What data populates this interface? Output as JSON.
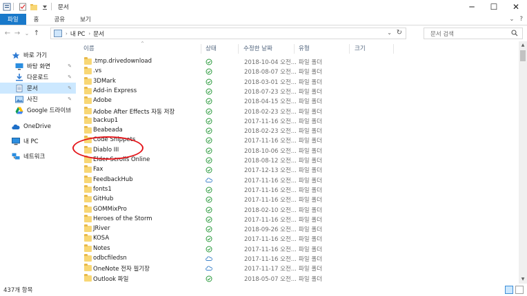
{
  "window": {
    "title": "문서",
    "minimize_glyph": "─",
    "maximize_glyph": "☐",
    "close_glyph": "✕"
  },
  "ribbon": {
    "tabs": [
      "파일",
      "홈",
      "공유",
      "보기"
    ],
    "expand_glyph": "⌄",
    "help_glyph": "?"
  },
  "address": {
    "back_glyph": "←",
    "forward_glyph": "→",
    "recent_glyph": "⌄",
    "up_glyph": "↑",
    "breadcrumb": [
      "내 PC",
      "문서"
    ],
    "separator_glyph": "›",
    "dropdown_glyph": "⌄",
    "refresh_glyph": "↻",
    "search_placeholder": "문서 검색",
    "search_icon": "search-icon"
  },
  "nav": {
    "items": [
      {
        "label": "바로 가기",
        "icon": "star-icon",
        "pinned": false
      },
      {
        "label": "바탕 화면",
        "icon": "desktop-icon",
        "pinned": true
      },
      {
        "label": "다운로드",
        "icon": "download-icon",
        "pinned": true
      },
      {
        "label": "문서",
        "icon": "documents-icon",
        "pinned": true,
        "selected": true
      },
      {
        "label": "사진",
        "icon": "pictures-icon",
        "pinned": true
      },
      {
        "label": "Google 드라이브",
        "icon": "google-drive-icon",
        "pinned": true
      },
      {
        "label": "OneDrive",
        "icon": "onedrive-icon",
        "pinned": false
      },
      {
        "label": "내 PC",
        "icon": "computer-icon",
        "pinned": false
      },
      {
        "label": "네트워크",
        "icon": "network-icon",
        "pinned": false
      }
    ],
    "pin_glyph": "✎"
  },
  "columns": [
    "이름",
    "상태",
    "수정한 날짜",
    "유형",
    "크기"
  ],
  "sort_glyph": "^",
  "files": [
    {
      "name": ".tmp.drivedownload",
      "status": "synced",
      "date": "2018-10-04 오전...",
      "type": "파일 폴더"
    },
    {
      "name": ".vs",
      "status": "synced",
      "date": "2018-08-07 오전...",
      "type": "파일 폴더"
    },
    {
      "name": "3DMark",
      "status": "synced",
      "date": "2018-03-01 오전...",
      "type": "파일 폴더"
    },
    {
      "name": "Add-in Express",
      "status": "synced",
      "date": "2018-07-23 오전...",
      "type": "파일 폴더"
    },
    {
      "name": "Adobe",
      "status": "synced",
      "date": "2018-04-15 오전...",
      "type": "파일 폴더"
    },
    {
      "name": "Adobe After Effects 자동 저장",
      "status": "synced",
      "date": "2018-02-23 오전...",
      "type": "파일 폴더"
    },
    {
      "name": "backup1",
      "status": "synced",
      "date": "2017-11-16 오전...",
      "type": "파일 폴더"
    },
    {
      "name": "Beabeada",
      "status": "synced",
      "date": "2018-02-23 오전...",
      "type": "파일 폴더"
    },
    {
      "name": "Code Snippets",
      "status": "synced",
      "date": "2017-11-16 오전...",
      "type": "파일 폴더"
    },
    {
      "name": "Diablo III",
      "status": "synced",
      "date": "2018-10-06 오전...",
      "type": "파일 폴더"
    },
    {
      "name": "Elder Scrolls Online",
      "status": "synced",
      "date": "2018-08-12 오전...",
      "type": "파일 폴더"
    },
    {
      "name": "Fax",
      "status": "synced",
      "date": "2017-12-13 오전...",
      "type": "파일 폴더"
    },
    {
      "name": "FeedbackHub",
      "status": "cloud",
      "date": "2017-11-16 오전...",
      "type": "파일 폴더"
    },
    {
      "name": "fonts1",
      "status": "synced",
      "date": "2017-11-16 오전...",
      "type": "파일 폴더"
    },
    {
      "name": "GitHub",
      "status": "synced",
      "date": "2017-11-16 오전...",
      "type": "파일 폴더"
    },
    {
      "name": "GOMMixPro",
      "status": "synced",
      "date": "2018-02-10 오전...",
      "type": "파일 폴더"
    },
    {
      "name": "Heroes of the Storm",
      "status": "synced",
      "date": "2017-11-16 오전...",
      "type": "파일 폴더"
    },
    {
      "name": "JRiver",
      "status": "synced",
      "date": "2018-09-26 오전...",
      "type": "파일 폴더"
    },
    {
      "name": "KOSA",
      "status": "synced",
      "date": "2017-11-16 오전...",
      "type": "파일 폴더"
    },
    {
      "name": "Notes",
      "status": "synced",
      "date": "2017-11-16 오전...",
      "type": "파일 폴더"
    },
    {
      "name": "odbcfiledsn",
      "status": "cloud",
      "date": "2017-11-16 오전...",
      "type": "파일 폴더"
    },
    {
      "name": "OneNote 전자 필기장",
      "status": "cloud",
      "date": "2017-11-17 오전...",
      "type": "파일 폴더"
    },
    {
      "name": "Outlook 파일",
      "status": "synced",
      "date": "2018-05-07 오전...",
      "type": "파일 폴더"
    },
    {
      "name": "",
      "status": "synced",
      "date": "",
      "type": ""
    }
  ],
  "statusbar": {
    "count": "437개 항목"
  },
  "colors": {
    "accent": "#1979ca",
    "selected_bg": "#cce8ff",
    "synced_green": "#2a9a3c",
    "cloud_blue": "#3d82c9",
    "annotation_red": "#e4161b"
  }
}
